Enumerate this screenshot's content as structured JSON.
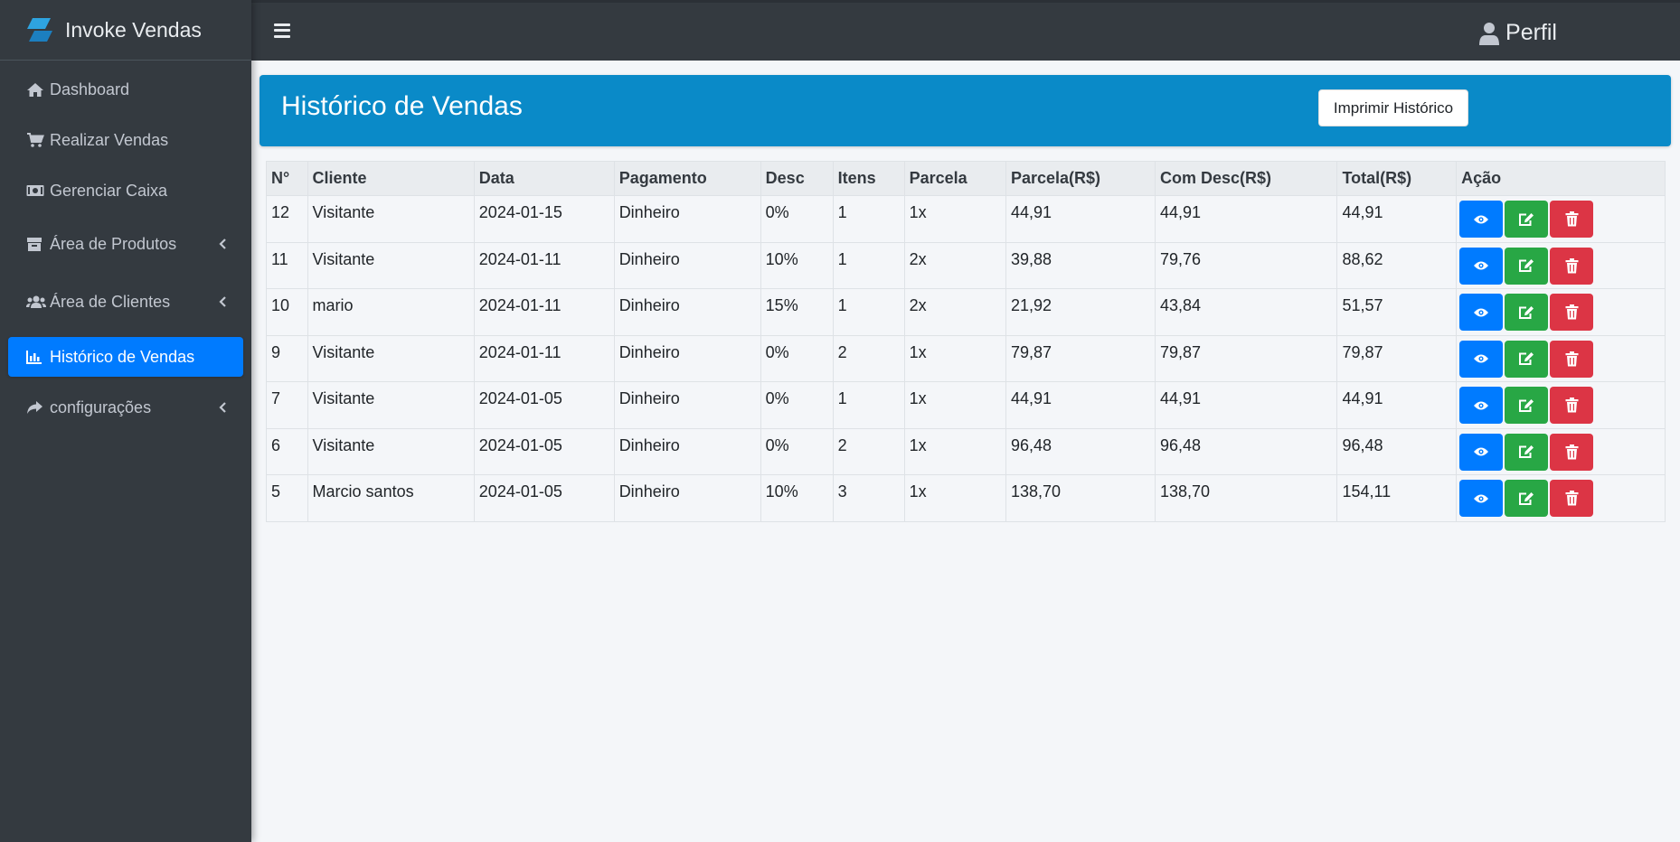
{
  "brand": {
    "name": "Invoke Vendas"
  },
  "sidebar": {
    "items": [
      {
        "label": "Dashboard",
        "icon": "home-icon"
      },
      {
        "label": "Realizar Vendas",
        "icon": "cart-icon"
      },
      {
        "label": "Gerenciar Caixa",
        "icon": "money-icon"
      },
      {
        "label": "Área de Produtos",
        "icon": "box-icon",
        "expandable": true
      },
      {
        "label": "Área de Clientes",
        "icon": "users-icon",
        "expandable": true
      },
      {
        "label": "Histórico de Vendas",
        "icon": "chart-icon",
        "active": true
      },
      {
        "label": "configurações",
        "icon": "share-icon",
        "expandable": true
      }
    ]
  },
  "topbar": {
    "profile_label": "Perfil"
  },
  "page": {
    "title": "Histórico de Vendas",
    "print_label": "Imprimir Histórico"
  },
  "table": {
    "headers": [
      "N°",
      "Cliente",
      "Data",
      "Pagamento",
      "Desc",
      "Itens",
      "Parcela",
      "Parcela(R$)",
      "Com Desc(R$)",
      "Total(R$)",
      "Ação"
    ],
    "rows": [
      [
        "12",
        "Visitante",
        "2024-01-15",
        "Dinheiro",
        "0%",
        "1",
        "1x",
        "44,91",
        "44,91",
        "44,91"
      ],
      [
        "11",
        "Visitante",
        "2024-01-11",
        "Dinheiro",
        "10%",
        "1",
        "2x",
        "39,88",
        "79,76",
        "88,62"
      ],
      [
        "10",
        "mario",
        "2024-01-11",
        "Dinheiro",
        "15%",
        "1",
        "2x",
        "21,92",
        "43,84",
        "51,57"
      ],
      [
        "9",
        "Visitante",
        "2024-01-11",
        "Dinheiro",
        "0%",
        "2",
        "1x",
        "79,87",
        "79,87",
        "79,87"
      ],
      [
        "7",
        "Visitante",
        "2024-01-05",
        "Dinheiro",
        "0%",
        "1",
        "1x",
        "44,91",
        "44,91",
        "44,91"
      ],
      [
        "6",
        "Visitante",
        "2024-01-05",
        "Dinheiro",
        "0%",
        "2",
        "1x",
        "96,48",
        "96,48",
        "96,48"
      ],
      [
        "5",
        "Marcio santos",
        "2024-01-05",
        "Dinheiro",
        "10%",
        "3",
        "1x",
        "138,70",
        "138,70",
        "154,11"
      ]
    ]
  },
  "colors": {
    "sidebar": "#343a40",
    "active": "#007bff",
    "header": "#0a8ac8",
    "view": "#007bff",
    "edit": "#28a745",
    "delete": "#dc3545"
  }
}
